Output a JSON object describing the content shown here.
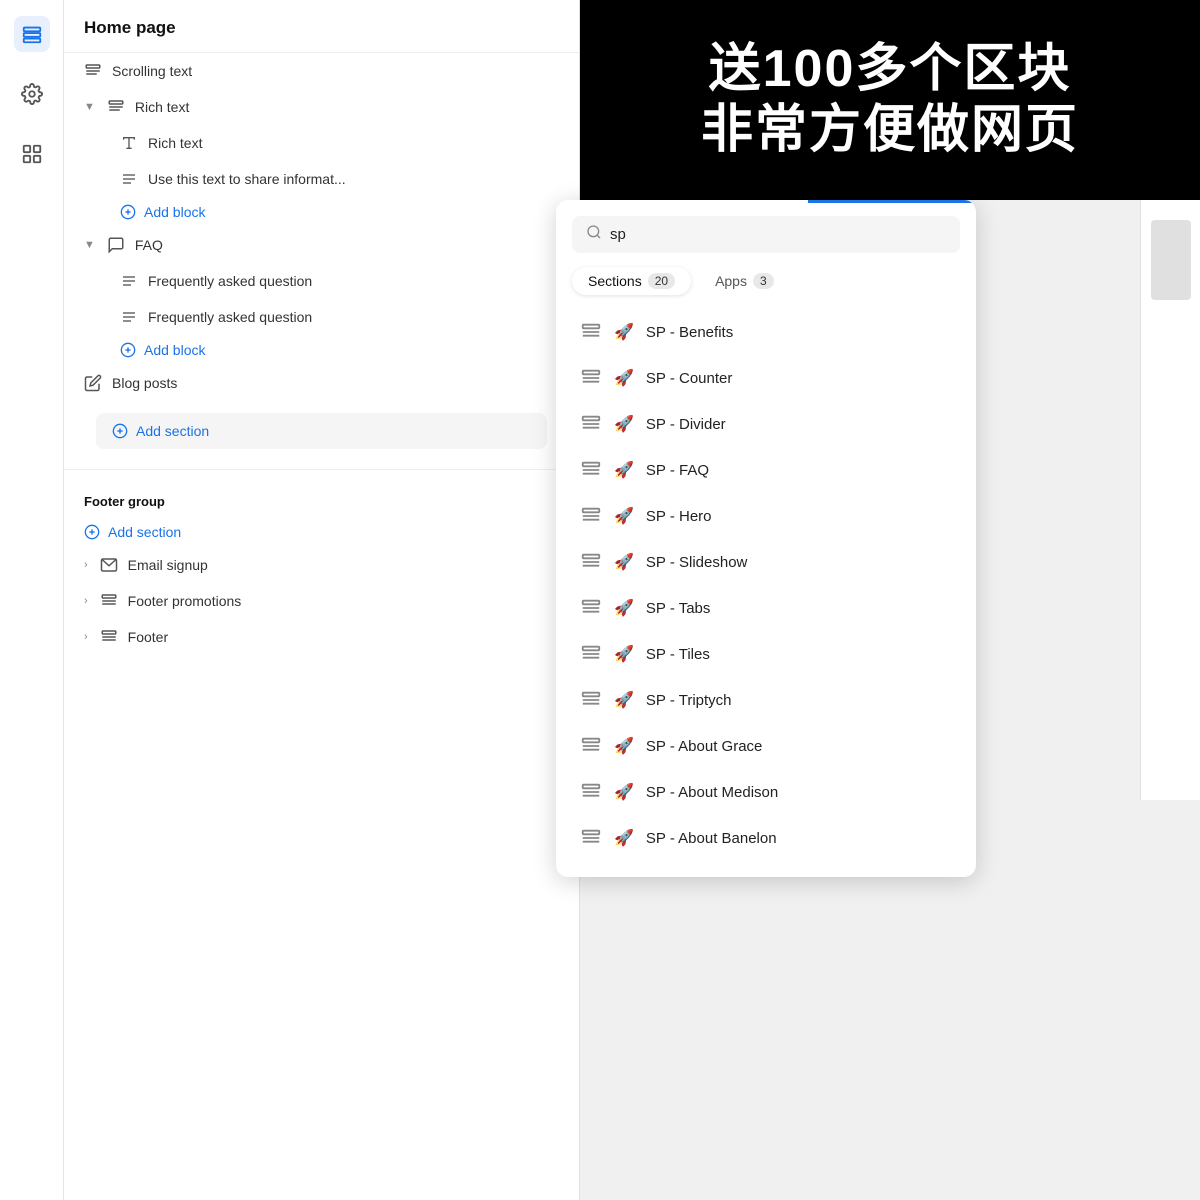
{
  "sidebar": {
    "icons": [
      {
        "name": "layers-icon",
        "label": "Layers",
        "active": true
      },
      {
        "name": "settings-icon",
        "label": "Settings",
        "active": false
      },
      {
        "name": "apps-icon",
        "label": "Apps",
        "active": false
      }
    ]
  },
  "panel": {
    "title": "Home page",
    "sections": [
      {
        "id": "scrolling-text",
        "label": "Scrolling text",
        "indent": 0,
        "type": "section"
      },
      {
        "id": "rich-text-parent",
        "label": "Rich text",
        "indent": 0,
        "type": "collapsible",
        "expanded": true
      },
      {
        "id": "rich-text-child-title",
        "label": "Rich text",
        "indent": 2,
        "type": "block-text"
      },
      {
        "id": "rich-text-child-desc",
        "label": "Use this text to share informat...",
        "indent": 2,
        "type": "block-lines"
      },
      {
        "id": "add-block-rich",
        "label": "Add block",
        "indent": 2,
        "type": "add-block"
      },
      {
        "id": "faq-parent",
        "label": "FAQ",
        "indent": 0,
        "type": "collapsible",
        "expanded": true
      },
      {
        "id": "faq-child-1",
        "label": "Frequently asked question",
        "indent": 2,
        "type": "block-lines"
      },
      {
        "id": "faq-child-2",
        "label": "Frequently asked question",
        "indent": 2,
        "type": "block-lines"
      },
      {
        "id": "add-block-faq",
        "label": "Add block",
        "indent": 2,
        "type": "add-block"
      },
      {
        "id": "blog-posts",
        "label": "Blog posts",
        "indent": 0,
        "type": "section-edit"
      },
      {
        "id": "add-section-main",
        "label": "Add section",
        "indent": 0,
        "type": "add-section"
      }
    ],
    "footer_group": {
      "label": "Footer group",
      "add_section": "Add section",
      "items": [
        {
          "id": "email-signup",
          "label": "Email signup",
          "collapsed": true
        },
        {
          "id": "footer-promotions",
          "label": "Footer promotions",
          "collapsed": true
        },
        {
          "id": "footer",
          "label": "Footer",
          "collapsed": true
        }
      ]
    }
  },
  "promo": {
    "line1": "送100多个区块",
    "line2": "非常方便做网页"
  },
  "search_popup": {
    "search_value": "sp",
    "search_placeholder": "Search",
    "tabs": [
      {
        "label": "Sections",
        "count": "20",
        "active": true
      },
      {
        "label": "Apps",
        "count": "3",
        "active": false
      }
    ],
    "results": [
      {
        "id": "sp-benefits",
        "label": "SP - Benefits"
      },
      {
        "id": "sp-counter",
        "label": "SP - Counter"
      },
      {
        "id": "sp-divider",
        "label": "SP - Divider"
      },
      {
        "id": "sp-faq",
        "label": "SP - FAQ"
      },
      {
        "id": "sp-hero",
        "label": "SP - Hero"
      },
      {
        "id": "sp-slideshow",
        "label": "SP - Slideshow"
      },
      {
        "id": "sp-tabs",
        "label": "SP - Tabs"
      },
      {
        "id": "sp-tiles",
        "label": "SP - Tiles"
      },
      {
        "id": "sp-triptych",
        "label": "SP - Triptych"
      },
      {
        "id": "sp-about-grace",
        "label": "SP - About Grace"
      },
      {
        "id": "sp-about-medison",
        "label": "SP - About Medison"
      },
      {
        "id": "sp-about-banelon",
        "label": "SP - About Banelon"
      }
    ]
  }
}
